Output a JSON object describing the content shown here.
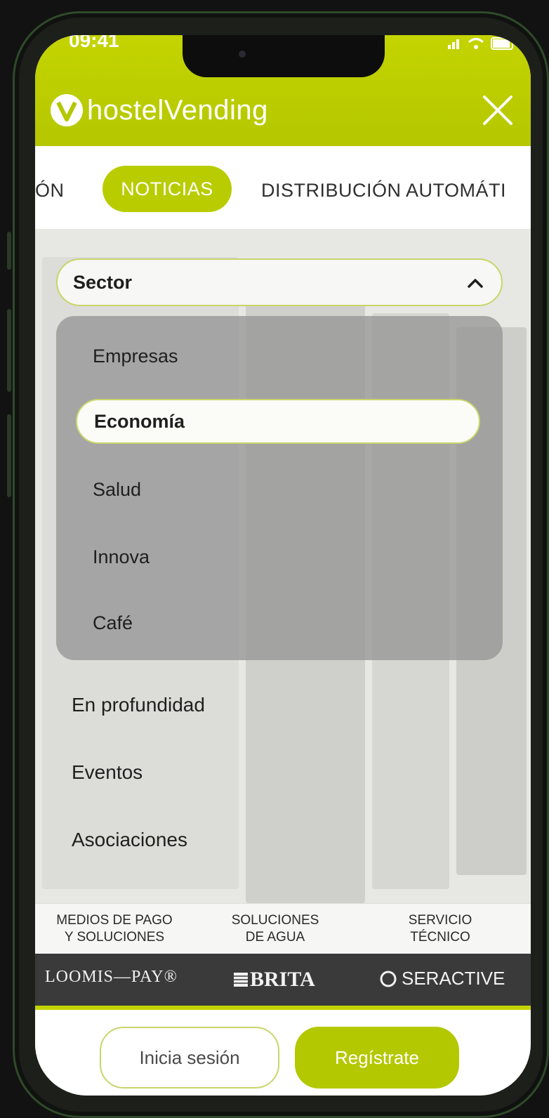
{
  "status_bar": {
    "time": "09:41",
    "icons": "signal-wifi-battery"
  },
  "brand": {
    "name": "hostelVending",
    "colors": {
      "accent": "#c4d400",
      "accent_dark": "#b4c700"
    }
  },
  "tabs": [
    {
      "label": "IÓN"
    },
    {
      "label": "NOTICIAS",
      "active": true
    },
    {
      "label": "DISTRIBUCIÓN AUTOMÁTI"
    }
  ],
  "sector_select": {
    "label": "Sector",
    "expanded": true,
    "options": [
      {
        "label": "Empresas"
      },
      {
        "label": "Economía",
        "selected": true
      },
      {
        "label": "Salud"
      },
      {
        "label": "Innova"
      },
      {
        "label": "Café"
      }
    ]
  },
  "menu": [
    {
      "label": "En profundidad"
    },
    {
      "label": "Eventos"
    },
    {
      "label": "Asociaciones"
    }
  ],
  "partners": {
    "labels": [
      "MEDIOS DE PAGO\nY SOLUCIONES",
      "SOLUCIONES\nDE AGUA",
      "SERVICIO\nTÉCNICO"
    ],
    "logos": [
      "LOOMIS—PAY®",
      "BRITA",
      "SERACTIVE"
    ]
  },
  "footer": {
    "login_label": "Inicia sesión",
    "register_label": "Regístrate"
  }
}
